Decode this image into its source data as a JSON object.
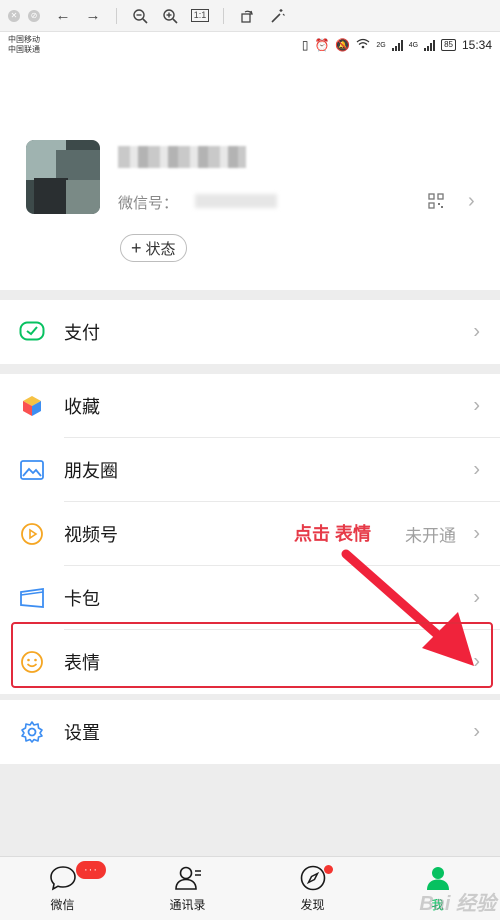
{
  "viewer_toolbar": {
    "icons": [
      "close-icon",
      "block-icon",
      "back-arrow-icon",
      "forward-arrow-icon",
      "zoom-out-icon",
      "zoom-in-icon",
      "actual-size-icon",
      "rotate-icon",
      "magic-wand-icon"
    ],
    "actual_size_label": "1:1"
  },
  "status_bar": {
    "carrier_1": "中国移动",
    "carrier_2": "中国联通",
    "battery": "85",
    "time": "15:34",
    "net_1": "2G",
    "net_2": "4G"
  },
  "profile": {
    "wechat_id_label": "微信号：",
    "status_button": "状态",
    "status_plus": "+"
  },
  "menu": {
    "pay": "支付",
    "favorites": "收藏",
    "moments": "朋友圈",
    "channels": "视频号",
    "channels_status": "未开通",
    "cards": "卡包",
    "stickers": "表情",
    "settings": "设置"
  },
  "annotation": {
    "text": "点击 表情",
    "color": "#e63a48"
  },
  "tabbar": {
    "chats": "微信",
    "chats_badge": "···",
    "contacts": "通讯录",
    "discover": "发现",
    "me": "我",
    "active_color": "#07c160"
  },
  "watermark": "Bai 经验"
}
